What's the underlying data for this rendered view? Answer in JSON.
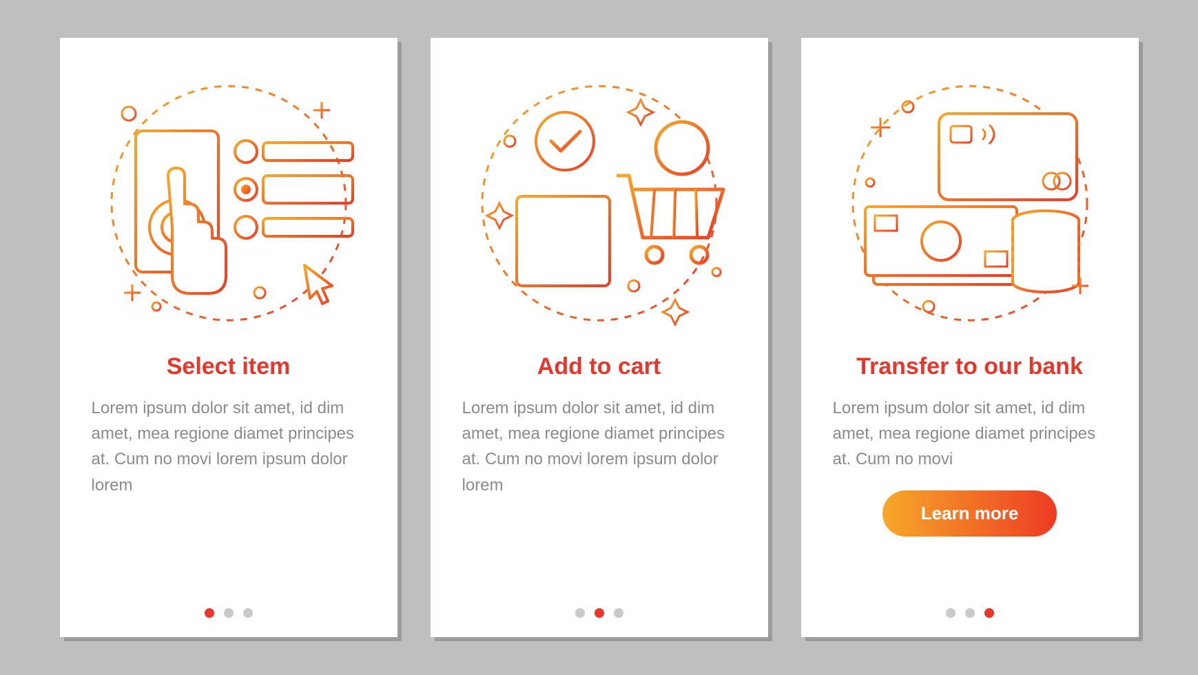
{
  "colors": {
    "page_bg": "#bfbfbf",
    "card_bg": "#ffffff",
    "accent": "#e8362b",
    "grad_from": "#f7a829",
    "grad_to": "#ed3b24",
    "body_text": "#8b8b8b",
    "dot_inactive": "#c9c9c9"
  },
  "cards": [
    {
      "icon_name": "select-item-illustration",
      "title": "Select item",
      "body": "Lorem ipsum dolor sit amet, id dim amet, mea regione diamet principes at. Cum no movi lorem ipsum dolor lorem",
      "cta": null,
      "active_dot": 0
    },
    {
      "icon_name": "add-to-cart-illustration",
      "title": "Add to cart",
      "body": "Lorem ipsum dolor sit amet, id dim amet, mea regione diamet principes at. Cum no movi lorem ipsum dolor lorem",
      "cta": null,
      "active_dot": 1
    },
    {
      "icon_name": "transfer-bank-illustration",
      "title": "Transfer to our bank",
      "body": "Lorem ipsum dolor sit amet, id dim amet, mea regione diamet principes at. Cum no movi",
      "cta": "Learn more",
      "active_dot": 2
    }
  ]
}
